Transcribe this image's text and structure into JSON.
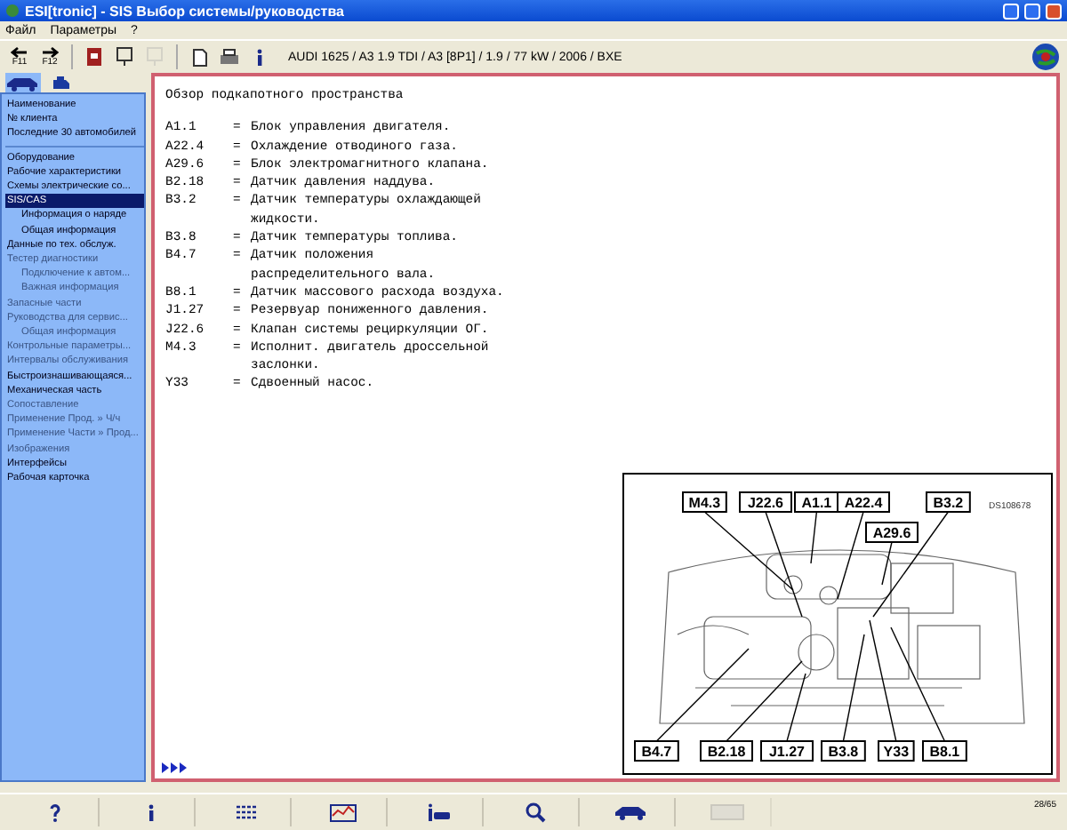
{
  "window": {
    "title": "ESI[tronic] - SIS Выбор системы/руководства"
  },
  "menu": [
    "Файл",
    "Параметры",
    "?"
  ],
  "toolbar": {
    "buttons": [
      {
        "kind": "back",
        "key": "F11",
        "disabled": false
      },
      {
        "kind": "forward",
        "key": "F12",
        "disabled": false
      },
      {
        "kind": "book",
        "disabled": false
      },
      {
        "kind": "tester",
        "disabled": false
      },
      {
        "kind": "tester",
        "disabled": true
      },
      {
        "kind": "document",
        "disabled": false
      },
      {
        "kind": "printer",
        "disabled": false
      },
      {
        "kind": "info",
        "disabled": false
      }
    ],
    "vehicle": "AUDI 1625 / A3 1.9 TDI / A3 [8P1] / 1.9 / 77 kW / 2006 / BXE"
  },
  "sidebar": {
    "tabs": [
      {
        "kind": "car",
        "selected": true
      },
      {
        "kind": "engine",
        "selected": false
      }
    ],
    "groups": [
      [
        {
          "label": "Наименование",
          "disabled": false,
          "selected": false
        },
        {
          "label": "№ клиента",
          "disabled": false,
          "selected": false
        },
        {
          "label": "Последние 30 автомобилей",
          "disabled": false,
          "selected": false
        }
      ],
      [
        {
          "label": "Оборудование",
          "disabled": false,
          "selected": false
        },
        {
          "label": "Рабочие характеристики",
          "disabled": false,
          "selected": false
        },
        {
          "label": "Схемы электрические со...",
          "disabled": false,
          "selected": false
        },
        {
          "label": "SIS/CAS",
          "disabled": false,
          "selected": true,
          "children": [
            {
              "label": "Информация о наряде",
              "disabled": false,
              "selected": false
            },
            {
              "label": "Общая информация",
              "disabled": false,
              "selected": false
            }
          ]
        },
        {
          "label": "Данные по тех. обслуж.",
          "disabled": false,
          "selected": false
        },
        {
          "label": "Тестер диагностики",
          "disabled": true,
          "selected": false,
          "children": [
            {
              "label": "Подключение к автом...",
              "disabled": true,
              "selected": false
            },
            {
              "label": "Важная информация",
              "disabled": true,
              "selected": false
            }
          ]
        },
        {
          "label": "Запасные части",
          "disabled": true,
          "selected": false
        },
        {
          "label": "Руководства для сервис...",
          "disabled": true,
          "selected": false,
          "children": [
            {
              "label": "Общая информация",
              "disabled": true,
              "selected": false
            }
          ]
        },
        {
          "label": "Контрольные параметры...",
          "disabled": true,
          "selected": false
        },
        {
          "label": "Интервалы обслуживания",
          "disabled": true,
          "selected": false
        },
        {
          "label": "Быстроизнашивающаяся...",
          "disabled": false,
          "selected": false
        },
        {
          "label": "Механическая часть",
          "disabled": false,
          "selected": false
        },
        {
          "label": "Сопоставление",
          "disabled": true,
          "selected": false
        },
        {
          "label": "Применение Прод. » Ч/ч",
          "disabled": true,
          "selected": false
        },
        {
          "label": "Применение Части » Прод...",
          "disabled": true,
          "selected": false
        },
        {
          "label": "Изображения",
          "disabled": true,
          "selected": false
        },
        {
          "label": "Интерфейсы",
          "disabled": false,
          "selected": false
        },
        {
          "label": "Рабочая карточка",
          "disabled": false,
          "selected": false
        }
      ]
    ]
  },
  "content": {
    "title": "Обзор подкапотного пространства",
    "legend": [
      {
        "code": "A1.1",
        "sep": "=",
        "lines": [
          "Блок управления двигателя."
        ]
      },
      {
        "code": "A22.4",
        "sep": "=",
        "lines": [
          "Охлаждение отводиного газа."
        ]
      },
      {
        "code": "A29.6",
        "sep": "=",
        "lines": [
          "Блок электромагнитного клапана."
        ]
      },
      {
        "code": "B2.18",
        "sep": "=",
        "lines": [
          "Датчик давления наддува."
        ]
      },
      {
        "code": "B3.2",
        "sep": "=",
        "lines": [
          "Датчик температуры охлаждающей",
          "жидкости."
        ]
      },
      {
        "code": "B3.8",
        "sep": "=",
        "lines": [
          "Датчик температуры топлива."
        ]
      },
      {
        "code": "B4.7",
        "sep": "=",
        "lines": [
          "Датчик положения",
          "распределительного вала."
        ]
      },
      {
        "code": "B8.1",
        "sep": "=",
        "lines": [
          "Датчик массового расхода воздуха."
        ]
      },
      {
        "code": "J1.27",
        "sep": "=",
        "lines": [
          "Резервуар пониженного давления."
        ]
      },
      {
        "code": "J22.6",
        "sep": "=",
        "lines": [
          "Клапан системы рециркуляции ОГ."
        ]
      },
      {
        "code": "M4.3",
        "sep": "=",
        "lines": [
          "Исполнит. двигатель дроссельной",
          "заслонки."
        ]
      },
      {
        "code": "Y33",
        "sep": "=",
        "lines": [
          "Сдвоенный насос."
        ]
      }
    ],
    "diagram": {
      "id": "DS108678",
      "top": [
        "M4.3",
        "J22.6",
        "A1.1",
        "A22.4",
        "B3.2"
      ],
      "middle": [
        "A29.6"
      ],
      "bottom": [
        "B4.7",
        "B2.18",
        "J1.27",
        "B3.8",
        "Y33",
        "B8.1"
      ]
    }
  },
  "bottom_toolbar": {
    "buttons": [
      {
        "kind": "help"
      },
      {
        "kind": "info"
      },
      {
        "kind": "list"
      },
      {
        "kind": "chart"
      },
      {
        "kind": "info-car"
      },
      {
        "kind": "zoom"
      },
      {
        "kind": "car"
      },
      {
        "kind": "screen",
        "disabled": true
      }
    ],
    "status": "28/65"
  }
}
